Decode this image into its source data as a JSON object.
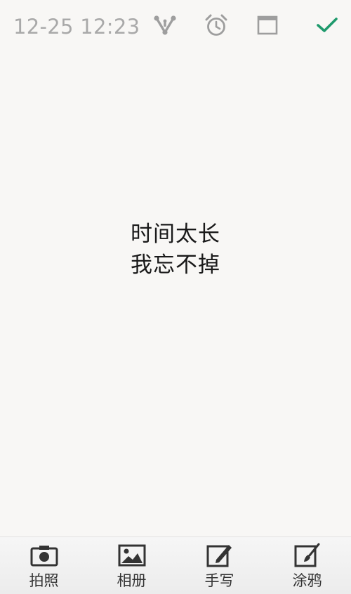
{
  "header": {
    "timestamp": "12-25 12:23",
    "icons": [
      "share-icon",
      "alarm-clock-icon",
      "window-icon",
      "checkmark-icon"
    ],
    "accent_color": "#1f9a6c",
    "icon_color": "#9e9e9e"
  },
  "note": {
    "lines": [
      "时间太长",
      "我忘不掉"
    ]
  },
  "toolbar": {
    "items": [
      {
        "label": "拍照",
        "icon": "camera-icon"
      },
      {
        "label": "相册",
        "icon": "picture-icon"
      },
      {
        "label": "手写",
        "icon": "handwrite-icon"
      },
      {
        "label": "涂鸦",
        "icon": "doodle-icon"
      }
    ]
  }
}
